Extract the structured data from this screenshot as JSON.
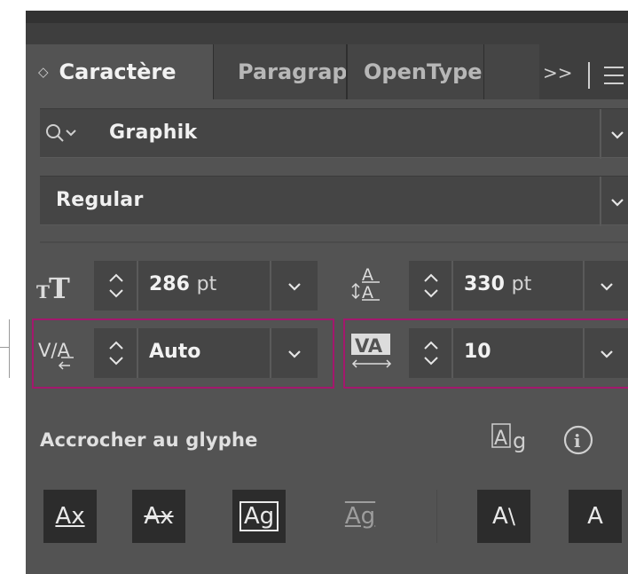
{
  "tabs": {
    "active_label": "Caractère",
    "tab2_label": "Paragraphe",
    "tab3_label": "OpenType",
    "overflow_label": ">>"
  },
  "font_family": {
    "value": "Graphik"
  },
  "font_style": {
    "value": "Regular"
  },
  "font_size": {
    "value": "286",
    "unit": "pt"
  },
  "leading": {
    "value": "330",
    "unit": "pt"
  },
  "kerning": {
    "value": "Auto"
  },
  "tracking": {
    "value": "10"
  },
  "snap": {
    "label": "Accrocher au glyphe"
  },
  "glyph_buttons": [
    {
      "label": "Ax"
    },
    {
      "label": "Ax"
    },
    {
      "label": "Ag"
    },
    {
      "label": "Ag"
    },
    {
      "label": "A"
    },
    {
      "label": "A"
    }
  ],
  "colors": {
    "panel_bg": "#535353",
    "field_bg": "#454545",
    "highlight": "#a3186d"
  }
}
